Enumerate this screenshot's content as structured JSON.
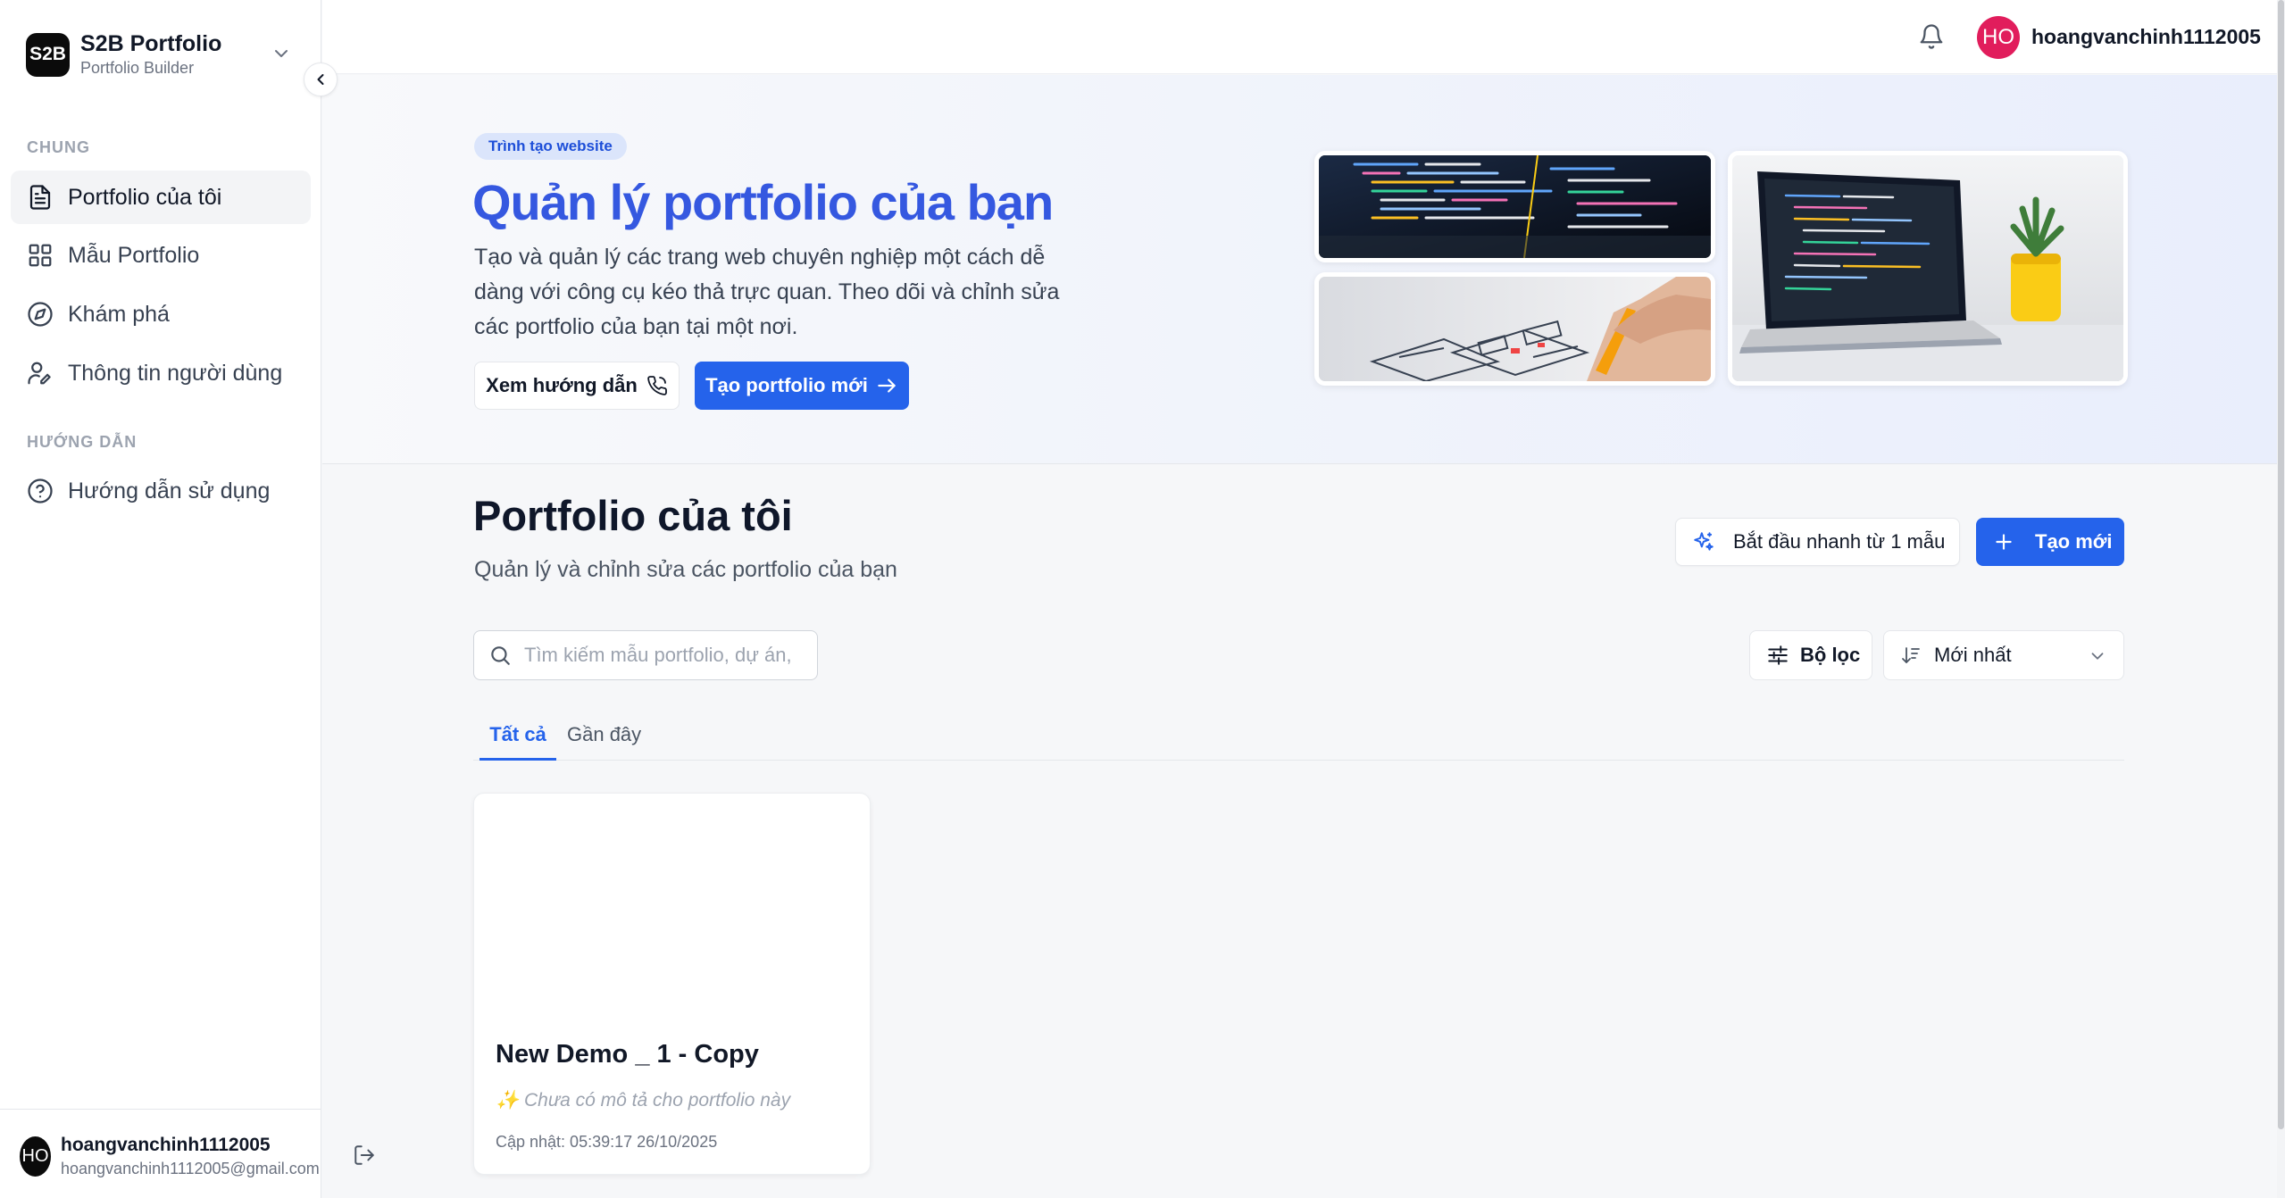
{
  "brand": {
    "logo": "S2B",
    "title": "S2B Portfolio",
    "subtitle": "Portfolio Builder"
  },
  "sidebar": {
    "sections": [
      {
        "label": "CHUNG"
      },
      {
        "label": "HƯỚNG DẪN"
      }
    ],
    "items": [
      {
        "label": "Portfolio của tôi",
        "icon": "file-text-icon",
        "active": true
      },
      {
        "label": "Mẫu Portfolio",
        "icon": "grid-icon"
      },
      {
        "label": "Khám phá",
        "icon": "compass-icon"
      },
      {
        "label": "Thông tin người dùng",
        "icon": "user-edit-icon"
      },
      {
        "label": "Hướng dẫn sử dụng",
        "icon": "help-circle-icon"
      }
    ],
    "footer": {
      "avatar": "HO",
      "name": "hoangvanchinh1112005",
      "email": "hoangvanchinh1112005@gmail.com"
    }
  },
  "topbar": {
    "avatar": "HO",
    "username": "hoangvanchinh1112005",
    "avatar_color": "#e11d5c"
  },
  "hero": {
    "badge": "Trình tạo website",
    "title": "Quản lý portfolio của bạn",
    "description": "Tạo và quản lý các trang web chuyên nghiệp một cách dễ dàng với công cụ kéo thả trực quan. Theo dõi và chỉnh sửa các portfolio của bạn tại một nơi.",
    "guide_button": "Xem hướng dẫn",
    "create_button": "Tạo portfolio mới"
  },
  "main": {
    "title": "Portfolio của tôi",
    "subtitle": "Quản lý và chỉnh sửa các portfolio của bạn",
    "quick_start_button": "Bắt đầu nhanh từ 1 mẫu",
    "new_button": "Tạo mới",
    "search": {
      "placeholder": "Tìm kiếm mẫu portfolio, dự án,",
      "value": ""
    },
    "filter_button": "Bộ lọc",
    "sort": {
      "selected": "Mới nhất"
    },
    "tabs": [
      {
        "label": "Tất cả",
        "active": true
      },
      {
        "label": "Gần đây"
      }
    ],
    "cards": [
      {
        "title": "New Demo _ 1 - Copy",
        "description": "✨ Chưa có mô tả cho portfolio này",
        "updated": "Cập nhật: 05:39:17 26/10/2025"
      }
    ]
  },
  "colors": {
    "accent": "#2563eb",
    "hero_title": "#3558e0",
    "badge_bg": "#dbe5fb"
  }
}
